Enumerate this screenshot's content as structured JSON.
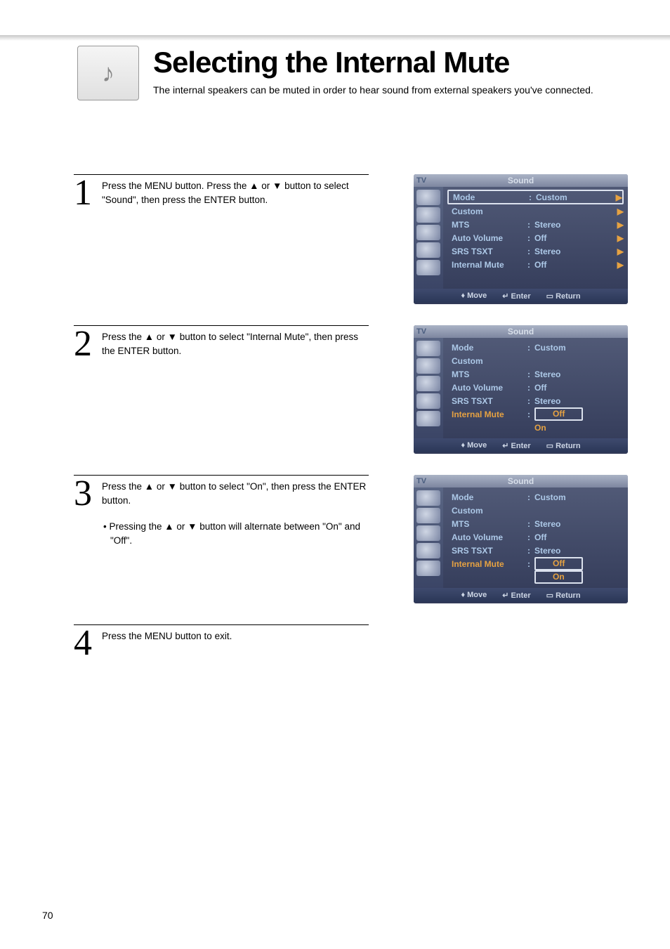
{
  "page_number": "70",
  "header": {
    "title": "Selecting the Internal Mute",
    "intro": "The internal speakers can be muted in order to hear sound from external speakers you've connected."
  },
  "steps": [
    {
      "num": "1",
      "text": "Press the MENU button. Press the ▲ or ▼ button to select \"Sound\", then press the ENTER button."
    },
    {
      "num": "2",
      "text": "Press the ▲ or ▼ button to select \"Internal Mute\", then press the ENTER button."
    },
    {
      "num": "3",
      "text": "Press the ▲ or ▼ button to select \"On\", then press the ENTER button.",
      "sub": "• Pressing the ▲ or ▼ button will alternate between \"On\" and \"Off\"."
    },
    {
      "num": "4",
      "text": "Press the MENU button to exit."
    }
  ],
  "osd_common": {
    "tv": "TV",
    "title": "Sound",
    "footer": {
      "move": "Move",
      "enter": "Enter",
      "return": "Return"
    },
    "labels": {
      "mode": "Mode",
      "custom": "Custom",
      "mts": "MTS",
      "auto_volume": "Auto Volume",
      "srs": "SRS TSXT",
      "internal_mute": "Internal Mute"
    },
    "values": {
      "custom": "Custom",
      "stereo": "Stereo",
      "off": "Off",
      "on": "On"
    }
  }
}
